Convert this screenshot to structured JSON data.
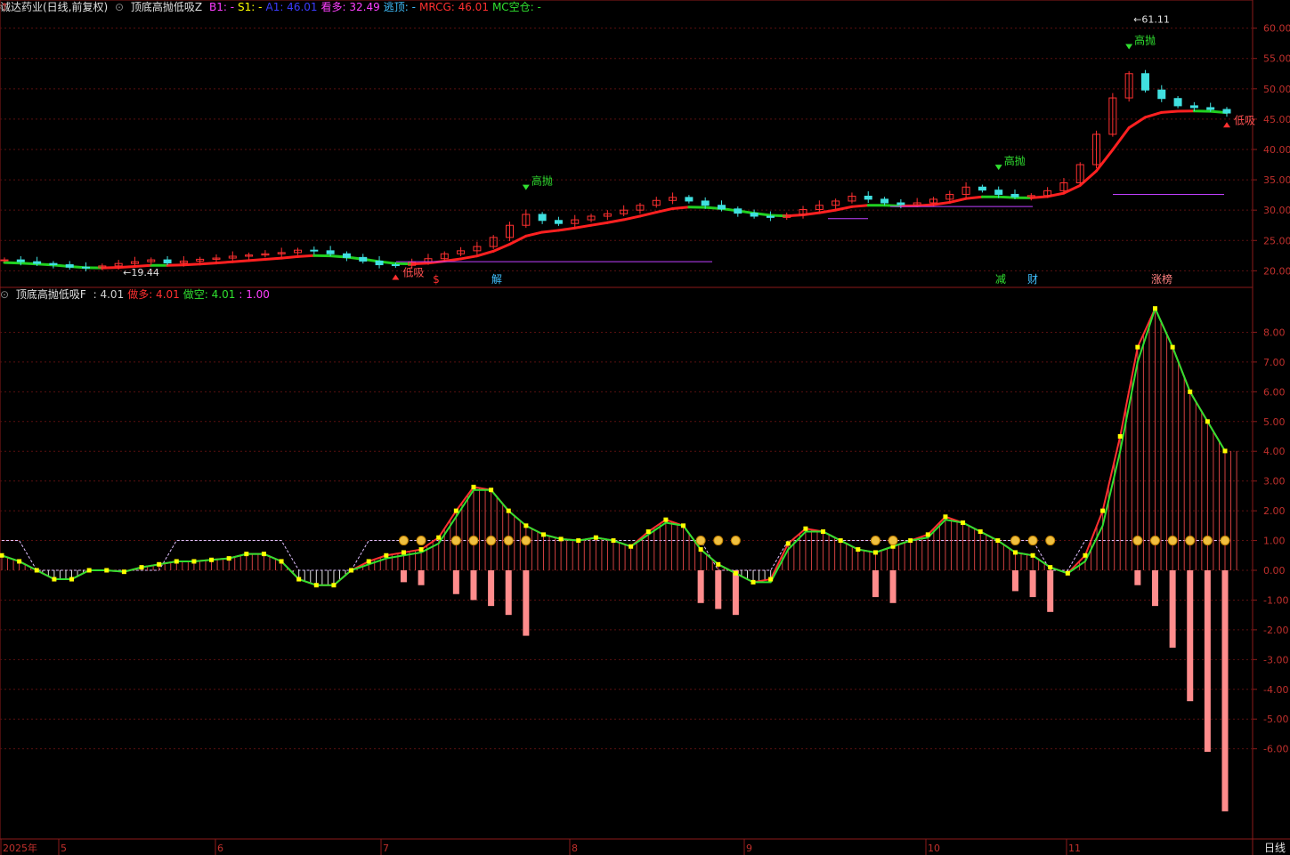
{
  "top_header": {
    "stock": "诚达药业(日线,前复权)",
    "indicator": "顶底高抛低吸Z",
    "items": [
      {
        "label": "B1:",
        "value": "-",
        "color": "#ff3cff"
      },
      {
        "label": "S1:",
        "value": "-",
        "color": "#ffff00"
      },
      {
        "label": "A1:",
        "value": "46.01",
        "color": "#3c3cff"
      },
      {
        "label": "看多:",
        "value": "32.49",
        "color": "#ff40ff"
      },
      {
        "label": "逃顶:",
        "value": "-",
        "color": "#40c0ff"
      },
      {
        "label": "MRCG:",
        "value": "46.01",
        "color": "#ff3030"
      },
      {
        "label": "MC空仓:",
        "value": "-",
        "color": "#30e030"
      }
    ]
  },
  "bottom_header": {
    "indicator": "顶底高抛低吸F",
    "items": [
      {
        "label": ":",
        "value": "4.01",
        "color": "#d0d0d0"
      },
      {
        "label": "做多:",
        "value": "4.01",
        "color": "#ff3030"
      },
      {
        "label": "做空:",
        "value": "4.01",
        "color": "#30e030"
      },
      {
        "label": ":",
        "value": "1.00",
        "color": "#ff40ff"
      }
    ]
  },
  "price_annotations": {
    "max_label": "61.11",
    "min_label": "19.44",
    "high_sell": "高抛",
    "low_buy": "低吸"
  },
  "event_markers": [
    "$",
    "解",
    "减",
    "财",
    "涨榜"
  ],
  "x_axis": {
    "labels": [
      "2025年",
      "5",
      "6",
      "7",
      "8",
      "9",
      "10",
      "11"
    ],
    "period": "日线"
  },
  "chart_data": [
    {
      "type": "candlestick",
      "title": "诚达药业",
      "ylim": [
        18,
        62
      ],
      "y_ticks": [
        "60.00",
        "55.00",
        "50.00",
        "45.00",
        "40.00",
        "35.00",
        "30.00",
        "25.00",
        "20.00"
      ],
      "close_trend": [
        21.8,
        21.5,
        21.2,
        21,
        20.6,
        20.5,
        20.8,
        21.2,
        21.5,
        21.8,
        21.3,
        21.6,
        21.9,
        22.1,
        22.4,
        22.6,
        22.8,
        23,
        23.4,
        23.3,
        22.8,
        22.2,
        21.6,
        21,
        20.9,
        21.4,
        22,
        22.8,
        23.3,
        24,
        25.5,
        27.5,
        29.3,
        28.3,
        27.8,
        28.4,
        29,
        29.4,
        30,
        30.8,
        31.6,
        32.1,
        31.5,
        30.8,
        30.2,
        29.5,
        29,
        28.8,
        29.2,
        30.1,
        30.8,
        31.5,
        32.3,
        31.8,
        31.2,
        30.9,
        31.2,
        31.8,
        32.6,
        33.8,
        33.3,
        32.6,
        32.2,
        32.4,
        33.2,
        34.5,
        37.5,
        42.5,
        48.5,
        52.5,
        49.8,
        48.4,
        47.2,
        46.9,
        46.6,
        46.01
      ],
      "low_buy_points": [
        {
          "i": 24
        },
        {
          "i": 75
        }
      ],
      "high_sell_points": [
        {
          "i": 32
        },
        {
          "i": 61
        },
        {
          "i": 69
        }
      ]
    },
    {
      "type": "line",
      "title": "顶底高抛低吸F",
      "ylim": [
        -9,
        9
      ],
      "y_ticks": [
        "8.00",
        "7.00",
        "6.00",
        "5.00",
        "4.00",
        "3.00",
        "2.00",
        "1.00",
        "0.00",
        "-1.00",
        "-2.00",
        "-3.00",
        "-4.00",
        "-5.00",
        "-6.00"
      ],
      "series": [
        {
          "name": "做多",
          "color": "#ff3030",
          "values": [
            0.5,
            0.3,
            0.0,
            -0.3,
            -0.3,
            0.0,
            0.0,
            -0.05,
            0.1,
            0.2,
            0.3,
            0.3,
            0.35,
            0.4,
            0.55,
            0.55,
            0.3,
            -0.3,
            -0.5,
            -0.5,
            0.0,
            0.3,
            0.5,
            0.6,
            0.7,
            1.1,
            2.0,
            2.8,
            2.7,
            2.0,
            1.5,
            1.2,
            1.05,
            1.0,
            1.1,
            1.0,
            0.8,
            1.3,
            1.7,
            1.5,
            0.7,
            0.2,
            -0.1,
            -0.4,
            -0.3,
            0.9,
            1.4,
            1.3,
            1.0,
            0.7,
            0.6,
            0.8,
            1.0,
            1.2,
            1.8,
            1.6,
            1.3,
            1.0,
            0.6,
            0.5,
            0.1,
            -0.1,
            0.5,
            2.0,
            4.5,
            7.5,
            8.8,
            7.5,
            6.0,
            5.0,
            4.01
          ]
        },
        {
          "name": "做空",
          "color": "#30e030",
          "values": [
            0.5,
            0.3,
            0.0,
            -0.3,
            -0.3,
            0.0,
            0.0,
            -0.05,
            0.1,
            0.2,
            0.3,
            0.3,
            0.35,
            0.4,
            0.55,
            0.55,
            0.3,
            -0.3,
            -0.5,
            -0.5,
            0.0,
            0.2,
            0.4,
            0.5,
            0.6,
            0.9,
            1.8,
            2.7,
            2.7,
            2.0,
            1.5,
            1.2,
            1.05,
            1.0,
            1.1,
            1.0,
            0.8,
            1.2,
            1.6,
            1.5,
            0.7,
            0.2,
            -0.1,
            -0.4,
            -0.4,
            0.7,
            1.3,
            1.3,
            1.0,
            0.7,
            0.6,
            0.8,
            1.0,
            1.1,
            1.7,
            1.6,
            1.3,
            1.0,
            0.6,
            0.5,
            0.1,
            -0.1,
            0.3,
            1.5,
            4.0,
            7.0,
            8.8,
            7.5,
            6.0,
            5.0,
            4.01
          ]
        }
      ],
      "neg_bars": [
        {
          "i": 23,
          "v": -0.4
        },
        {
          "i": 24,
          "v": -0.5
        },
        {
          "i": 26,
          "v": -0.8
        },
        {
          "i": 27,
          "v": -1.0
        },
        {
          "i": 28,
          "v": -1.2
        },
        {
          "i": 29,
          "v": -1.5
        },
        {
          "i": 30,
          "v": -2.2
        },
        {
          "i": 40,
          "v": -1.1
        },
        {
          "i": 41,
          "v": -1.3
        },
        {
          "i": 42,
          "v": -1.5
        },
        {
          "i": 50,
          "v": -0.9
        },
        {
          "i": 51,
          "v": -1.1
        },
        {
          "i": 58,
          "v": -0.7
        },
        {
          "i": 59,
          "v": -0.9
        },
        {
          "i": 60,
          "v": -1.4
        },
        {
          "i": 65,
          "v": -0.5
        },
        {
          "i": 66,
          "v": -1.2
        },
        {
          "i": 67,
          "v": -2.6
        },
        {
          "i": 68,
          "v": -4.4
        },
        {
          "i": 69,
          "v": -6.1
        },
        {
          "i": 70,
          "v": -8.1
        }
      ]
    }
  ]
}
